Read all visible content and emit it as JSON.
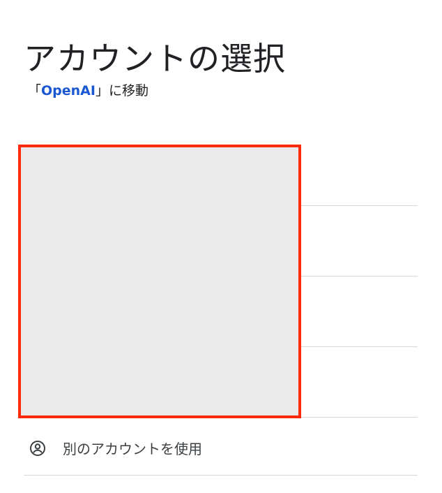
{
  "header": {
    "title": "アカウントの選択",
    "subtitle_prefix": "「",
    "subtitle_app": "OpenAI",
    "subtitle_suffix": "」に移動"
  },
  "accounts": {
    "rows": 4,
    "redacted": true
  },
  "other_account": {
    "icon": "account-circle-icon",
    "label": "別のアカウントを使用"
  },
  "colors": {
    "link": "#1a57d2",
    "redaction_border": "#ff2a0a",
    "redaction_fill": "#eaeaea",
    "divider": "#d7d7d7"
  }
}
